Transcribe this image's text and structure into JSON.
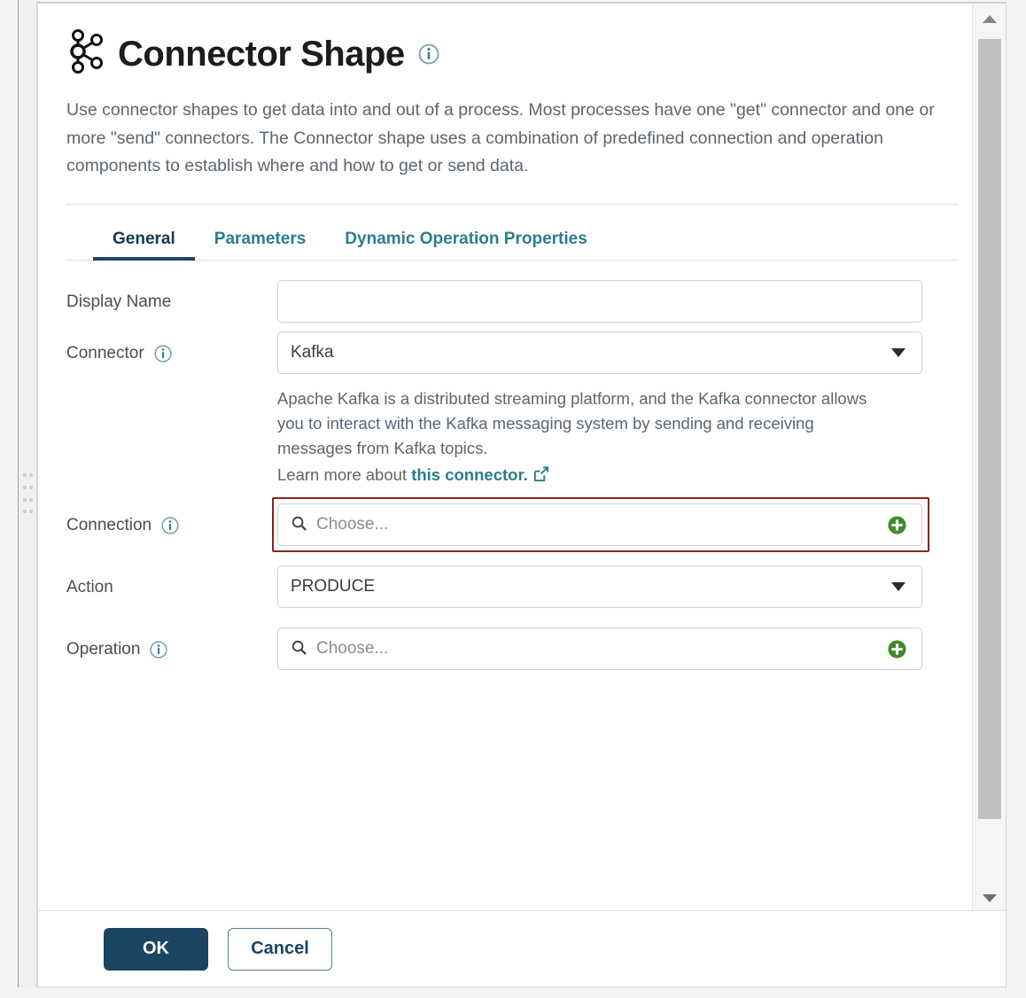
{
  "dialog": {
    "title": "Connector Shape",
    "title_icon": "connector-node-graph-icon",
    "title_info_icon": "info-icon",
    "description": "Use connector shapes to get data into and out of a process. Most processes have one \"get\" connector and one or more \"send\" connectors. The Connector shape uses a combination of predefined connection and operation components to establish where and how to get or send data."
  },
  "tabs": [
    {
      "label": "General",
      "active": true
    },
    {
      "label": "Parameters",
      "active": false
    },
    {
      "label": "Dynamic Operation Properties",
      "active": false
    }
  ],
  "form": {
    "display_name": {
      "label": "Display Name",
      "value": "",
      "placeholder": ""
    },
    "connector": {
      "label": "Connector",
      "value": "Kafka",
      "has_info": true,
      "description": "Apache Kafka is a distributed streaming platform, and the Kafka connector allows you to interact with the Kafka messaging system by sending and receiving messages from Kafka topics.",
      "learn_more_prefix": "Learn more about ",
      "learn_more_link": "this connector.",
      "external_link_icon": "external-link-icon"
    },
    "connection": {
      "label": "Connection",
      "placeholder": "Choose...",
      "has_info": true,
      "highlighted": true,
      "highlight_color": "#8b2226",
      "search_icon": "search-icon",
      "add_icon": "green-plus-icon"
    },
    "action": {
      "label": "Action",
      "value": "PRODUCE",
      "has_info": false
    },
    "operation": {
      "label": "Operation",
      "placeholder": "Choose...",
      "has_info": true,
      "search_icon": "search-icon",
      "add_icon": "green-plus-icon"
    }
  },
  "footer": {
    "ok_label": "OK",
    "cancel_label": "Cancel"
  },
  "scrollbar": {
    "up_icon": "scroll-up-arrow-icon",
    "down_icon": "scroll-down-arrow-icon"
  },
  "colors": {
    "accent_teal": "#2a7e8c",
    "primary_navy": "#1b4562",
    "highlight_red": "#8b2226",
    "add_green": "#3f8a28"
  }
}
